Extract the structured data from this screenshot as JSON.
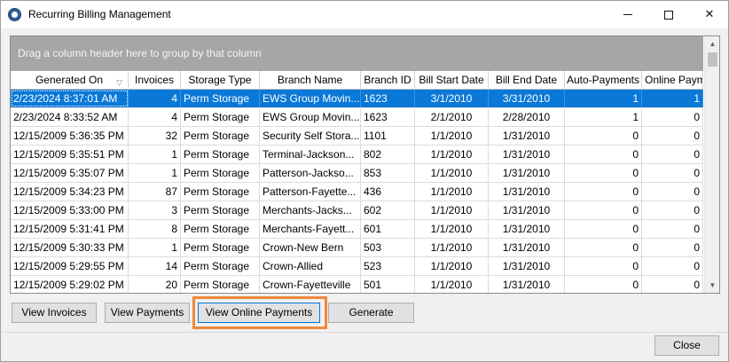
{
  "window": {
    "title": "Recurring Billing Management",
    "controls": {
      "minimize": "minimize-icon",
      "maximize": "maximize-icon",
      "close": "✕"
    }
  },
  "grid": {
    "group_panel_text": "Drag a column header here to group by that column",
    "sort_indicator": "▽",
    "columns": [
      "Generated On",
      "Invoices",
      "Storage Type",
      "Branch Name",
      "Branch ID",
      "Bill Start Date",
      "Bill End Date",
      "Auto-Payments",
      "Online Paym"
    ],
    "rows": [
      [
        "2/23/2024 8:37:01 AM",
        "4",
        "Perm Storage",
        "EWS Group Movin...",
        "1623",
        "3/1/2010",
        "3/31/2010",
        "1",
        "1"
      ],
      [
        "2/23/2024 8:33:52 AM",
        "4",
        "Perm Storage",
        "EWS Group Movin...",
        "1623",
        "2/1/2010",
        "2/28/2010",
        "1",
        "0"
      ],
      [
        "12/15/2009 5:36:35 PM",
        "32",
        "Perm Storage",
        "Security Self Stora...",
        "1101",
        "1/1/2010",
        "1/31/2010",
        "0",
        "0"
      ],
      [
        "12/15/2009 5:35:51 PM",
        "1",
        "Perm Storage",
        "Terminal-Jackson...",
        "802",
        "1/1/2010",
        "1/31/2010",
        "0",
        "0"
      ],
      [
        "12/15/2009 5:35:07 PM",
        "1",
        "Perm Storage",
        "Patterson-Jackso...",
        "853",
        "1/1/2010",
        "1/31/2010",
        "0",
        "0"
      ],
      [
        "12/15/2009 5:34:23 PM",
        "87",
        "Perm Storage",
        "Patterson-Fayette...",
        "436",
        "1/1/2010",
        "1/31/2010",
        "0",
        "0"
      ],
      [
        "12/15/2009 5:33:00 PM",
        "3",
        "Perm Storage",
        "Merchants-Jacks...",
        "602",
        "1/1/2010",
        "1/31/2010",
        "0",
        "0"
      ],
      [
        "12/15/2009 5:31:41 PM",
        "8",
        "Perm Storage",
        "Merchants-Fayett...",
        "601",
        "1/1/2010",
        "1/31/2010",
        "0",
        "0"
      ],
      [
        "12/15/2009 5:30:33 PM",
        "1",
        "Perm Storage",
        "Crown-New Bern",
        "503",
        "1/1/2010",
        "1/31/2010",
        "0",
        "0"
      ],
      [
        "12/15/2009 5:29:55 PM",
        "14",
        "Perm Storage",
        "Crown-Allied",
        "523",
        "1/1/2010",
        "1/31/2010",
        "0",
        "0"
      ],
      [
        "12/15/2009 5:29:02 PM",
        "20",
        "Perm Storage",
        "Crown-Fayetteville",
        "501",
        "1/1/2010",
        "1/31/2010",
        "0",
        "0"
      ]
    ],
    "selected_row": 0
  },
  "actions": {
    "view_invoices": "View Invoices",
    "view_payments": "View Payments",
    "view_online_payments": "View Online Payments",
    "generate": "Generate",
    "close": "Close"
  },
  "colors": {
    "selection": "#0a78d7",
    "highlight": "#f0883a",
    "group_panel": "#a6a6a6"
  }
}
